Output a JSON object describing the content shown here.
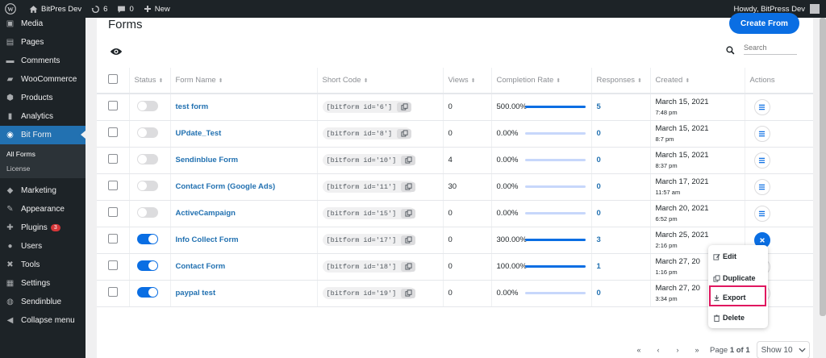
{
  "adminbar": {
    "site_name": "BitPres Dev",
    "updates_count": "6",
    "comments_count": "0",
    "new_label": "New",
    "howdy": "Howdy, BitPress Dev"
  },
  "sidebar": {
    "items_top": [
      {
        "label": "Media",
        "icon": "media-icon"
      },
      {
        "label": "Pages",
        "icon": "pages-icon"
      },
      {
        "label": "Comments",
        "icon": "comments-icon"
      },
      {
        "label": "WooCommerce",
        "icon": "woocommerce-icon"
      },
      {
        "label": "Products",
        "icon": "products-icon"
      },
      {
        "label": "Analytics",
        "icon": "analytics-icon"
      },
      {
        "label": "Bit Form",
        "icon": "bitform-icon",
        "current": true
      }
    ],
    "submenu": [
      "All Forms",
      "License"
    ],
    "items_bottom": [
      {
        "label": "Marketing",
        "icon": "marketing-icon"
      },
      {
        "label": "Appearance",
        "icon": "appearance-icon"
      },
      {
        "label": "Plugins",
        "icon": "plugins-icon",
        "badge": "3"
      },
      {
        "label": "Users",
        "icon": "users-icon"
      },
      {
        "label": "Tools",
        "icon": "tools-icon"
      },
      {
        "label": "Settings",
        "icon": "settings-icon"
      },
      {
        "label": "Sendinblue",
        "icon": "sendinblue-icon"
      },
      {
        "label": "Collapse menu",
        "icon": "collapse-icon"
      }
    ]
  },
  "page": {
    "title": "Forms",
    "create_button": "Create From",
    "search_placeholder": "Search"
  },
  "table": {
    "headers": [
      "Status",
      "Form Name",
      "Short Code",
      "Views",
      "Completion Rate",
      "Responses",
      "Created",
      "Actions"
    ],
    "rows": [
      {
        "status": false,
        "name": "test form",
        "shortcode": "[bitform id='6']",
        "views": "0",
        "rate_label": "500.00%",
        "rate": 1.0,
        "responses": "5",
        "date": "March 15, 2021",
        "time": "7:48 pm"
      },
      {
        "status": false,
        "name": "UPdate_Test",
        "shortcode": "[bitform id='8']",
        "views": "0",
        "rate_label": "0.00%",
        "rate": 0,
        "responses": "0",
        "date": "March 15, 2021",
        "time": "8:7 pm"
      },
      {
        "status": false,
        "name": "Sendinblue Form",
        "shortcode": "[bitform id='10']",
        "views": "4",
        "rate_label": "0.00%",
        "rate": 0,
        "responses": "0",
        "date": "March 15, 2021",
        "time": "8:37 pm"
      },
      {
        "status": false,
        "name": "Contact Form (Google Ads)",
        "shortcode": "[bitform id='11']",
        "views": "30",
        "rate_label": "0.00%",
        "rate": 0,
        "responses": "0",
        "date": "March 17, 2021",
        "time": "11:57 am"
      },
      {
        "status": false,
        "name": "ActiveCampaign",
        "shortcode": "[bitform id='15']",
        "views": "0",
        "rate_label": "0.00%",
        "rate": 0,
        "responses": "0",
        "date": "March 20, 2021",
        "time": "6:52 pm"
      },
      {
        "status": true,
        "name": "Info Collect Form",
        "shortcode": "[bitform id='17']",
        "views": "0",
        "rate_label": "300.00%",
        "rate": 1.0,
        "responses": "3",
        "date": "March 25, 2021",
        "time": "2:16 pm",
        "menu_open": true
      },
      {
        "status": true,
        "name": "Contact Form",
        "shortcode": "[bitform id='18']",
        "views": "0",
        "rate_label": "100.00%",
        "rate": 1.0,
        "responses": "1",
        "date": "March 27, 20",
        "time": "1:16 pm"
      },
      {
        "status": true,
        "name": "paypal test",
        "shortcode": "[bitform id='19']",
        "views": "0",
        "rate_label": "0.00%",
        "rate": 0,
        "responses": "0",
        "date": "March 27, 20",
        "time": "3:34 pm"
      }
    ]
  },
  "action_menu": {
    "edit": "Edit",
    "duplicate": "Duplicate",
    "export": "Export",
    "delete": "Delete"
  },
  "pagination": {
    "first": "«",
    "prev": "‹",
    "next": "›",
    "last": "»",
    "page_word": "Page",
    "page_info": "1 of 1",
    "show_label": "Show 10"
  },
  "colors": {
    "accent": "#0a6ee3",
    "highlight": "#e0175f",
    "sidebar_bg": "#1d2327"
  }
}
